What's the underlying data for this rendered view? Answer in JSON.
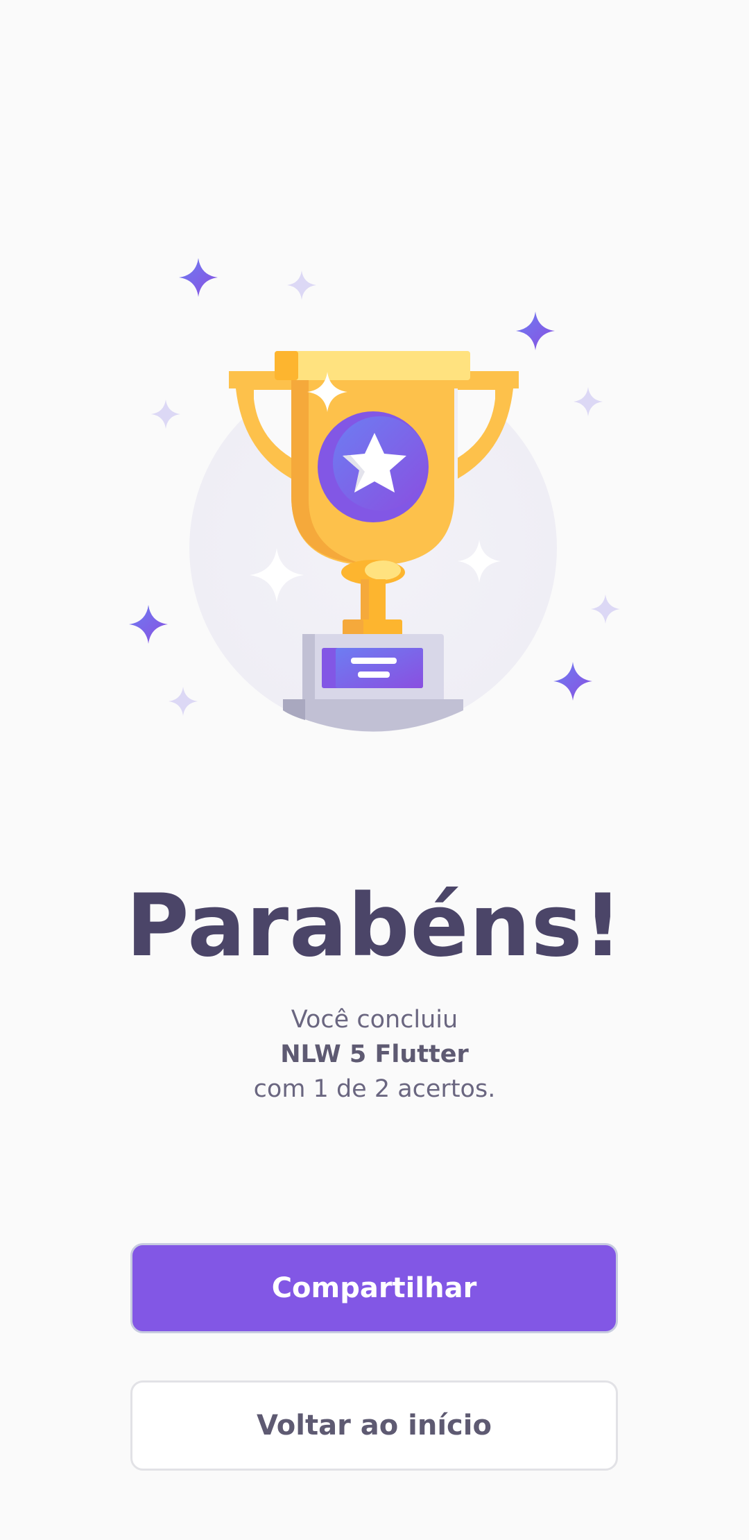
{
  "screen": {
    "background_color": "#FAFAFA"
  },
  "illustration": {
    "icon": "trophy-icon",
    "colors": {
      "gold": "#FDC14B",
      "gold_dark": "#F5A93B",
      "gold_light": "#FFE27F",
      "purple": "#8257E5",
      "sparkle_purple": "#7C5FE6",
      "sparkle_light": "#DCD8F5",
      "base_gray": "#D8D7E8",
      "base_shadow": "#C1C0D4"
    }
  },
  "result": {
    "title": "Parabéns!",
    "line1": "Você concluiu",
    "course_name": "NLW 5 Flutter",
    "line3": "com 1 de 2 acertos.",
    "correct": 1,
    "total": 2
  },
  "actions": {
    "share_label": "Compartilhar",
    "home_label": "Voltar ao início",
    "share_color": "#8257E5"
  }
}
